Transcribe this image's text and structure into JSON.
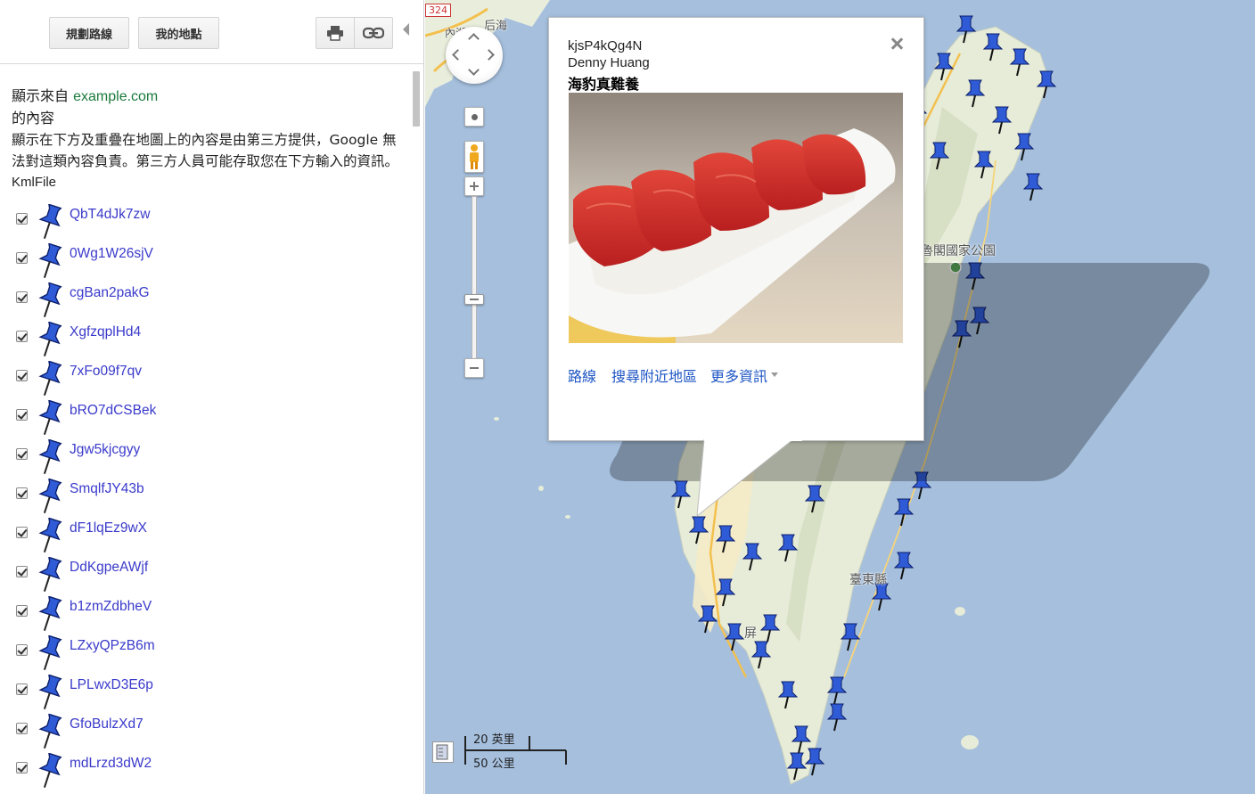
{
  "toolbar": {
    "route_label": "規劃路線",
    "my_places_label": "我的地點",
    "print_icon": "printer-icon",
    "link_icon": "link-icon"
  },
  "content": {
    "source_prefix": "顯示來自",
    "source_link": "example.com",
    "source_suffix": "的內容",
    "disclaimer": "顯示在下方及重疊在地圖上的內容是由第三方提供，Google 無法對這類內容負責。第三方人員可能存取您在下方輸入的資訊。",
    "kml_title": "KmlFile"
  },
  "items": [
    {
      "label": "QbT4dJk7zw",
      "checked": true
    },
    {
      "label": "0Wg1W26sjV",
      "checked": true
    },
    {
      "label": "cgBan2pakG",
      "checked": true
    },
    {
      "label": "XgfzqplHd4",
      "checked": true
    },
    {
      "label": "7xFo09f7qv",
      "checked": true
    },
    {
      "label": "bRO7dCSBek",
      "checked": true
    },
    {
      "label": "Jgw5kjcgyy",
      "checked": true
    },
    {
      "label": "SmqlfJY43b",
      "checked": true
    },
    {
      "label": "dF1lqEz9wX",
      "checked": true
    },
    {
      "label": "DdKgpeAWjf",
      "checked": true
    },
    {
      "label": "b1zmZdbheV",
      "checked": true
    },
    {
      "label": "LZxyQPzB6m",
      "checked": true
    },
    {
      "label": "LPLwxD3E6p",
      "checked": true
    },
    {
      "label": "GfoBulzXd7",
      "checked": true
    },
    {
      "label": "mdLrzd3dW2",
      "checked": true
    }
  ],
  "map": {
    "labels": {
      "road_number": "324",
      "city_top": "后海",
      "city_top_small": "內湖",
      "national_park": "魯閣國家公園",
      "county_east": "臺東縣",
      "city_south": "屏"
    },
    "scale": {
      "imperial": "20 英里",
      "metric": "50 公里"
    },
    "colors": {
      "sea": "#a5bfdd",
      "land": "#e9eedc",
      "pin": "#2f5bd6"
    }
  },
  "info_window": {
    "id": "kjsP4kQg4N",
    "author": "Denny Huang",
    "caption": "海豹真難養",
    "photo_icon": "sushi-photo",
    "actions": {
      "directions": "路線",
      "search_nearby": "搜尋附近地區",
      "more_info": "更多資訊"
    }
  }
}
